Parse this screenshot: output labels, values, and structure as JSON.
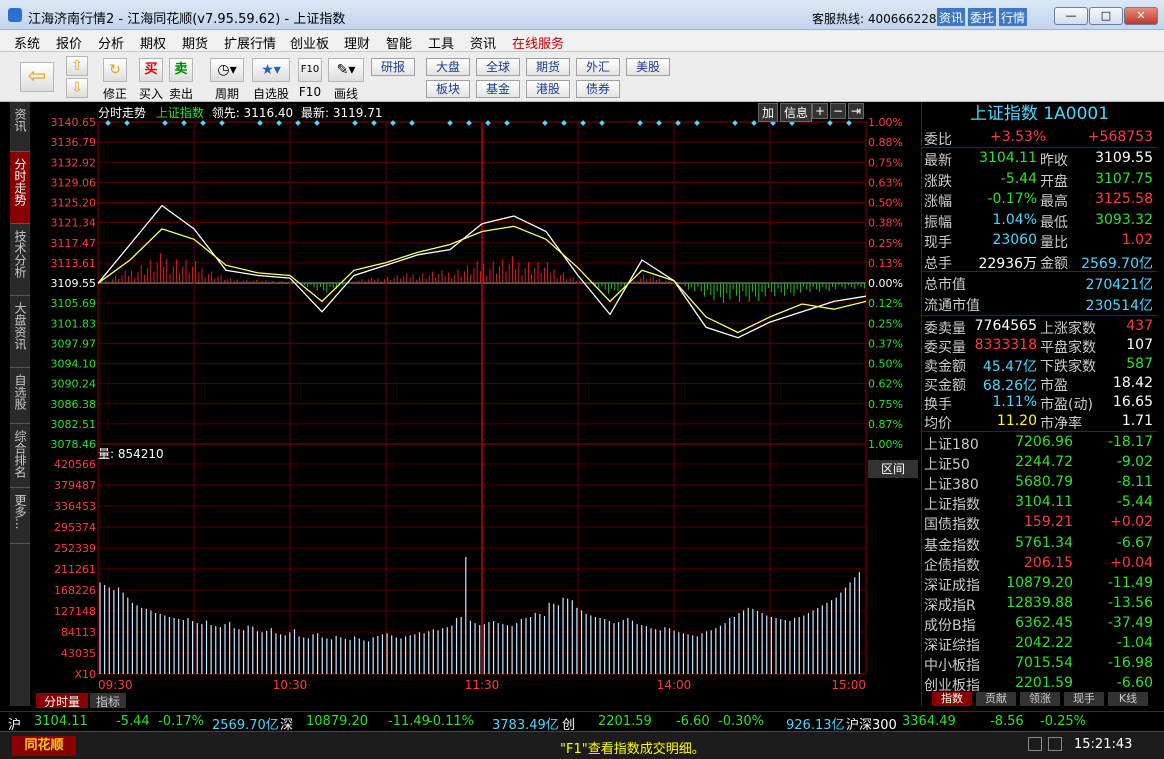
{
  "window": {
    "title": "江海济南行情2 - 江海同花顺(v7.95.59.62) - 上证指数",
    "hotline_label": "客服热线: 4006662288",
    "title_buttons": [
      "资讯",
      "委托",
      "行情"
    ],
    "controls": {
      "minimize": "—",
      "maximize": "□",
      "close": "✕"
    }
  },
  "menu": [
    "系统",
    "报价",
    "分析",
    "期权",
    "期货",
    "扩展行情",
    "创业板",
    "理财",
    "智能",
    "工具",
    "资讯",
    "在线服务"
  ],
  "toolbar": {
    "labels": {
      "fix": "修正",
      "buy": "买入",
      "sell": "卖出",
      "period": "周期",
      "watchlist": "自选股",
      "f10": "F10",
      "draw": "画线"
    },
    "buy_icon": "买",
    "sell_icon": "卖",
    "f10_icon": "F10",
    "grid": [
      "研报",
      "大盘",
      "全球",
      "期货",
      "外汇",
      "美股",
      "板块",
      "基金",
      "港股",
      "债券"
    ]
  },
  "left_tabs": [
    "资讯",
    "分时走势",
    "技术分析",
    "大盘资讯",
    "自选股",
    "综合排名",
    "更多..."
  ],
  "chart_header": {
    "mode": "分时走势",
    "name": "上证指数",
    "lead": "领先: 3116.40",
    "latest": "最新: 3119.71",
    "buttons": {
      "add": "加",
      "info": "信息",
      "plus": "+",
      "minus": "−",
      "expand": "⇥"
    }
  },
  "volume_header": "量: 854210",
  "range_button": "区间",
  "bottom_tabs": [
    "分时量",
    "指标"
  ],
  "chart_data": {
    "type": "line",
    "title": "分时走势",
    "price_ticks": [
      "3140.65",
      "3136.79",
      "3132.92",
      "3129.06",
      "3125.20",
      "3121.34",
      "3117.47",
      "3113.61",
      "3109.55",
      "3105.69",
      "3101.83",
      "3097.97",
      "3094.10",
      "3090.24",
      "3086.38",
      "3082.51",
      "3078.46"
    ],
    "pct_ticks": [
      "1.00%",
      "0.88%",
      "0.75%",
      "0.63%",
      "0.50%",
      "0.38%",
      "0.25%",
      "0.13%",
      "0.00%",
      "0.12%",
      "0.25%",
      "0.37%",
      "0.50%",
      "0.62%",
      "0.75%",
      "0.87%",
      "1.00%"
    ],
    "ylim": [
      3078.46,
      3140.65
    ],
    "prev_close": 3109.55,
    "volume_ticks": [
      "420566",
      "379487",
      "336453",
      "295374",
      "252339",
      "211261",
      "168226",
      "127148",
      "84113",
      "43035",
      "X10"
    ],
    "volume_max": 420566,
    "time_labels": [
      "09:30",
      "10:30",
      "11:30",
      "14:00",
      "15:00"
    ],
    "series": [
      {
        "name": "最新",
        "color": "#ffffff",
        "x": [
          0,
          10,
          20,
          30,
          40,
          50,
          60,
          70,
          80,
          90,
          100,
          110,
          120,
          130,
          140,
          150,
          160,
          170,
          180,
          190,
          200,
          210,
          220,
          230,
          240
        ],
        "values": [
          3109.5,
          3117,
          3124.5,
          3120,
          3112,
          3111,
          3110.5,
          3104,
          3111,
          3113,
          3115,
          3116,
          3121,
          3122.5,
          3119.5,
          3111,
          3103.5,
          3114,
          3110,
          3101,
          3099,
          3102,
          3104,
          3106,
          3107
        ]
      },
      {
        "name": "领先",
        "color": "#ffff66",
        "x": [
          0,
          10,
          20,
          30,
          40,
          50,
          60,
          70,
          80,
          90,
          100,
          110,
          120,
          130,
          140,
          150,
          160,
          170,
          180,
          190,
          200,
          210,
          220,
          230,
          240
        ],
        "values": [
          3109.5,
          3114,
          3120,
          3118,
          3113,
          3111.5,
          3111,
          3106,
          3112,
          3113.5,
          3115.5,
          3117,
          3119.5,
          3120.5,
          3118,
          3112.5,
          3106,
          3112,
          3110,
          3103,
          3100,
          3103,
          3105.5,
          3104.5,
          3106
        ]
      }
    ],
    "volume": [
      180,
      175,
      170,
      165,
      170,
      160,
      150,
      140,
      135,
      130,
      128,
      125,
      120,
      118,
      115,
      112,
      110,
      108,
      106,
      110,
      104,
      100,
      98,
      105,
      96,
      94,
      92,
      98,
      102,
      90,
      88,
      86,
      95,
      93,
      84,
      82,
      85,
      90,
      80,
      78,
      76,
      82,
      88,
      74,
      72,
      70,
      78,
      80,
      72,
      70,
      68,
      75,
      72,
      69,
      67,
      74,
      70,
      66,
      64,
      72,
      75,
      78,
      80,
      76,
      72,
      70,
      74,
      76,
      78,
      82,
      80,
      84,
      88,
      86,
      90,
      92,
      95,
      110,
      112,
      230,
      105,
      100,
      96,
      98,
      102,
      104,
      100,
      98,
      96,
      94,
      100,
      108,
      110,
      112,
      120,
      118,
      114,
      140,
      138,
      135,
      150,
      148,
      145,
      130,
      125,
      118,
      115,
      112,
      110,
      108,
      104,
      100,
      102,
      106,
      110,
      105,
      98,
      96,
      94,
      90,
      88,
      86,
      92,
      90,
      85,
      82,
      80,
      78,
      76,
      74,
      80,
      84,
      86,
      90,
      95,
      100,
      110,
      112,
      120,
      125,
      130,
      128,
      124,
      120,
      115,
      112,
      110,
      108,
      106,
      104,
      110,
      112,
      115,
      120,
      125,
      130,
      135,
      140,
      145,
      150,
      160,
      170,
      180,
      190,
      200
    ]
  },
  "panel": {
    "title": "上证指数 1A0001",
    "weibi": {
      "label": "委比",
      "pct": "+3.53%",
      "diff": "+568753"
    },
    "quote": [
      {
        "l1": "最新",
        "v1": "3104.11",
        "c1": "#2fe02f",
        "l2": "昨收",
        "v2": "3109.55",
        "c2": "#ffffff"
      },
      {
        "l1": "涨跌",
        "v1": "-5.44",
        "c1": "#2fe02f",
        "l2": "开盘",
        "v2": "3107.75",
        "c2": "#2fe02f"
      },
      {
        "l1": "涨幅",
        "v1": "-0.17%",
        "c1": "#2fe02f",
        "l2": "最高",
        "v2": "3125.58",
        "c2": "#ff3b3b"
      },
      {
        "l1": "振幅",
        "v1": "1.04%",
        "c1": "#4bd8ff",
        "l2": "最低",
        "v2": "3093.32",
        "c2": "#2fe02f"
      },
      {
        "l1": "现手",
        "v1": "23060",
        "c1": "#4bd8ff",
        "l2": "量比",
        "v2": "1.02",
        "c2": "#ff3b3b"
      },
      {
        "l1": "总手",
        "v1": "22936万",
        "c1": "#ffffff",
        "l2": "金额",
        "v2": "2569.70亿",
        "c2": "#4bd8ff"
      }
    ],
    "market_value": [
      {
        "label": "总市值",
        "value": "270421亿"
      },
      {
        "label": "流通市值",
        "value": "230514亿"
      }
    ],
    "depth": [
      {
        "l1": "委卖量",
        "v1": "7764565",
        "c1": "#ffffff",
        "l2": "上涨家数",
        "v2": "437",
        "c2": "#ff3b3b"
      },
      {
        "l1": "委买量",
        "v1": "8333318",
        "c1": "#ff3b3b",
        "l2": "平盘家数",
        "v2": "107",
        "c2": "#ffffff"
      },
      {
        "l1": "卖金额",
        "v1": "45.47亿",
        "c1": "#4bd8ff",
        "l2": "下跌家数",
        "v2": "587",
        "c2": "#2fe02f"
      },
      {
        "l1": "买金额",
        "v1": "68.26亿",
        "c1": "#4bd8ff",
        "l2": "市盈",
        "v2": "18.42",
        "c2": "#ffffff"
      },
      {
        "l1": "换手",
        "v1": "1.11%",
        "c1": "#4bd8ff",
        "l2": "市盈(动)",
        "v2": "16.65",
        "c2": "#ffffff"
      },
      {
        "l1": "均价",
        "v1": "11.20",
        "c1": "#ffff00",
        "l2": "市净率",
        "v2": "1.71",
        "c2": "#ffffff"
      }
    ],
    "indices": [
      {
        "name": "上证180",
        "price": "7206.96",
        "change": "-18.17",
        "pc": "#2fe02f",
        "cc": "#2fe02f"
      },
      {
        "name": "上证50",
        "price": "2244.72",
        "change": "-9.02",
        "pc": "#2fe02f",
        "cc": "#2fe02f"
      },
      {
        "name": "上证380",
        "price": "5680.79",
        "change": "-8.11",
        "pc": "#2fe02f",
        "cc": "#2fe02f"
      },
      {
        "name": "上证指数",
        "price": "3104.11",
        "change": "-5.44",
        "pc": "#2fe02f",
        "cc": "#2fe02f"
      },
      {
        "name": "国债指数",
        "price": "159.21",
        "change": "+0.02",
        "pc": "#ff3b3b",
        "cc": "#ff3b3b"
      },
      {
        "name": "基金指数",
        "price": "5761.34",
        "change": "-6.67",
        "pc": "#2fe02f",
        "cc": "#2fe02f"
      },
      {
        "name": "企债指数",
        "price": "206.15",
        "change": "+0.04",
        "pc": "#ff3b3b",
        "cc": "#ff3b3b"
      },
      {
        "name": "深证成指",
        "price": "10879.20",
        "change": "-11.49",
        "pc": "#2fe02f",
        "cc": "#2fe02f"
      },
      {
        "name": "深成指R",
        "price": "12839.88",
        "change": "-13.56",
        "pc": "#2fe02f",
        "cc": "#2fe02f"
      },
      {
        "name": "成份B指",
        "price": "6362.45",
        "change": "-37.49",
        "pc": "#2fe02f",
        "cc": "#2fe02f"
      },
      {
        "name": "深证综指",
        "price": "2042.22",
        "change": "-1.04",
        "pc": "#2fe02f",
        "cc": "#2fe02f"
      },
      {
        "name": "中小板指",
        "price": "7015.54",
        "change": "-16.98",
        "pc": "#2fe02f",
        "cc": "#2fe02f"
      },
      {
        "name": "创业板指",
        "price": "2201.59",
        "change": "-6.60",
        "pc": "#2fe02f",
        "cc": "#2fe02f"
      }
    ],
    "tabs": [
      "指数",
      "贡献",
      "领涨",
      "现手",
      "K线"
    ]
  },
  "statusbar": [
    {
      "text": "沪",
      "color": "#ffffff"
    },
    {
      "text": "3104.11",
      "color": "#2fe02f"
    },
    {
      "text": "-5.44",
      "color": "#2fe02f"
    },
    {
      "text": "-0.17%",
      "color": "#2fe02f"
    },
    {
      "text": "2569.70亿",
      "color": "#4bd8ff"
    },
    {
      "text": "深",
      "color": "#ffffff"
    },
    {
      "text": "10879.20",
      "color": "#2fe02f"
    },
    {
      "text": "-11.49",
      "color": "#2fe02f"
    },
    {
      "text": "-0.11%",
      "color": "#2fe02f"
    },
    {
      "text": "3783.49亿",
      "color": "#4bd8ff"
    },
    {
      "text": "创",
      "color": "#ffffff"
    },
    {
      "text": "2201.59",
      "color": "#2fe02f"
    },
    {
      "text": "-6.60",
      "color": "#2fe02f"
    },
    {
      "text": "-0.30%",
      "color": "#2fe02f"
    },
    {
      "text": "926.13亿",
      "color": "#4bd8ff"
    },
    {
      "text": "沪深300",
      "color": "#ffffff"
    },
    {
      "text": "3364.49",
      "color": "#2fe02f"
    },
    {
      "text": "-8.56",
      "color": "#2fe02f"
    },
    {
      "text": "-0.25%",
      "color": "#2fe02f"
    }
  ],
  "bottombar": {
    "logo": "同花顺",
    "message": "\"F1\"查看指数成交明细。",
    "clock": "15:21:43"
  }
}
